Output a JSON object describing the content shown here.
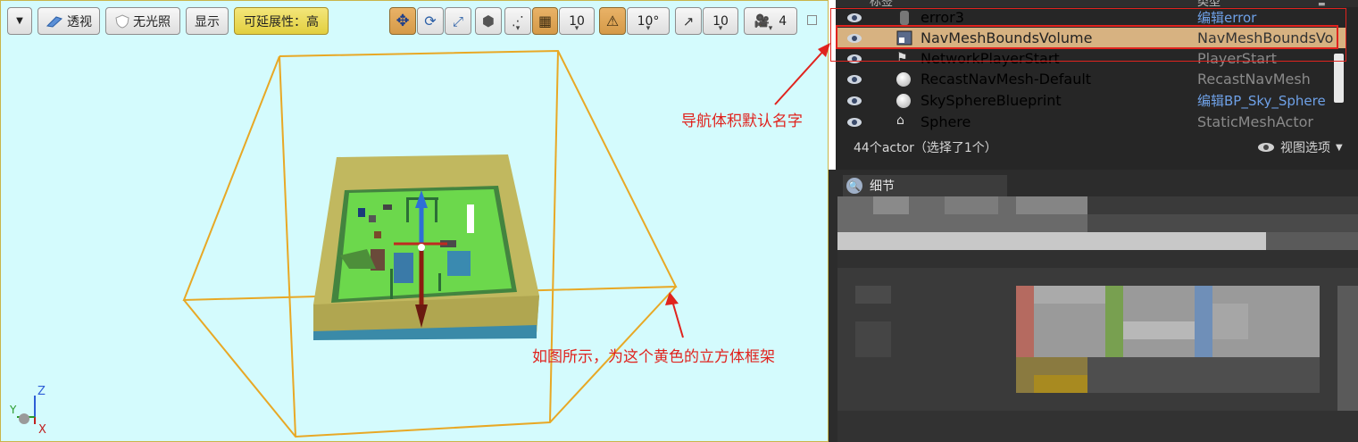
{
  "viewport": {
    "toolbar": {
      "perspective_label": "透视",
      "unlit_label": "无光照",
      "show_label": "显示",
      "scalability_label": "可延展性：高",
      "grid_snap_value": "10",
      "rotation_snap_value": "10°",
      "scale_snap_value": "10",
      "camera_speed_value": "4"
    },
    "axes": {
      "z": "Z",
      "x": "X",
      "y": "Y"
    }
  },
  "outliner": {
    "header": {
      "label_col": "标签",
      "type_col": "类型"
    },
    "rows": [
      {
        "name": "error3",
        "type": "编辑error",
        "type_is_link": true
      },
      {
        "name": "NavMeshBoundsVolume",
        "type": "NavMeshBoundsVolu",
        "selected": true
      },
      {
        "name": "NetworkPlayerStart",
        "type": "PlayerStart"
      },
      {
        "name": "RecastNavMesh-Default",
        "type": "RecastNavMesh"
      },
      {
        "name": "SkySphereBlueprint",
        "type": "编辑BP_Sky_Sphere",
        "type_is_link": true
      },
      {
        "name": "Sphere",
        "type": "StaticMeshActor"
      }
    ],
    "footer_count": "44个actor（选择了1个）",
    "view_options": "视图选项"
  },
  "details": {
    "tab_label": "细节"
  },
  "annotations": {
    "nav_default_name": "导航体积默认名字",
    "yellow_cube_frame": "如图所示，为这个黄色的立方体框架"
  },
  "colors": {
    "viewport_bg": "#d4fbfd",
    "bounds_wire": "#e8a825",
    "selection": "#d7b281",
    "annotation_red": "#e0231e",
    "link_blue": "#6ea0e6"
  }
}
